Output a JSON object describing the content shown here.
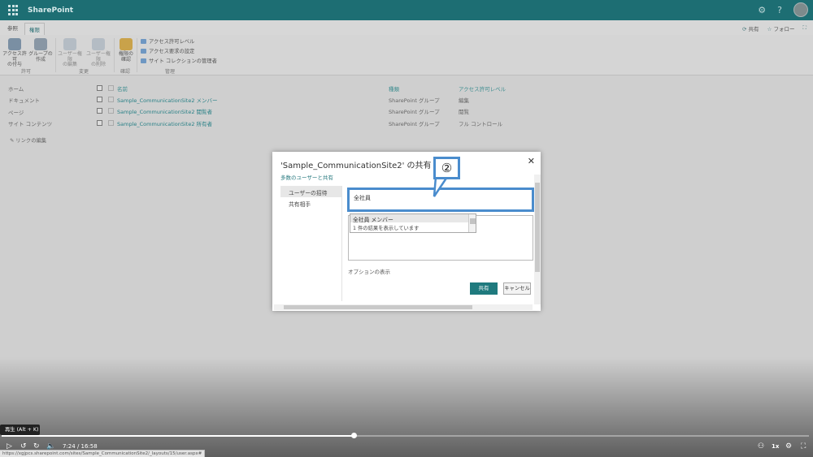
{
  "suitebar": {
    "brand": "SharePoint",
    "bg_color": "#1d6e73"
  },
  "tabs": {
    "items": [
      {
        "label": "参照"
      },
      {
        "label": "権限"
      }
    ],
    "right": {
      "share": "共有",
      "follow": "フォロー"
    }
  },
  "ribbon": {
    "buttons": [
      {
        "label_l1": "アクセス許可",
        "label_l2": "の付与"
      },
      {
        "label_l1": "グループの",
        "label_l2": "作成"
      },
      {
        "label_l1": "ユーザー権限",
        "label_l2": "の編集"
      },
      {
        "label_l1": "ユーザー権限",
        "label_l2": "の削除"
      },
      {
        "label_l1": "権限の",
        "label_l2": "確認"
      }
    ],
    "small_items": [
      "アクセス許可レベル",
      "アクセス要求の設定",
      "サイト コレクションの管理者"
    ],
    "groups": {
      "grant": "許可",
      "modify": "変更",
      "check": "確認",
      "manage": "管理"
    }
  },
  "leftnav": {
    "items": [
      "ホーム",
      "ドキュメント",
      "ページ",
      "サイト コンテンツ"
    ],
    "edit_links": "リンクの編集"
  },
  "group_table": {
    "headers": {
      "name": "名前",
      "type": "種類",
      "permission": "アクセス許可レベル"
    },
    "rows": [
      {
        "name": "Sample_CommunicationSite2 メンバー",
        "type": "SharePoint グループ",
        "permission": "編集"
      },
      {
        "name": "Sample_CommunicationSite2 閲覧者",
        "type": "SharePoint グループ",
        "permission": "閲覧"
      },
      {
        "name": "Sample_CommunicationSite2 所有者",
        "type": "SharePoint グループ",
        "permission": "フル コントロール"
      }
    ]
  },
  "dialog": {
    "title": "'Sample_CommunicationSite2' の共有",
    "subtitle": "多数のユーザーと共有",
    "nav": [
      "ユーザーの招待",
      "共有相手"
    ],
    "invite_value": "全社員",
    "suggestion": "全社員 メンバー",
    "result_count": "1 件の結果を表示しています",
    "options_label": "オプションの表示",
    "share_button": "共有",
    "cancel_button": "キャンセル"
  },
  "callout": {
    "label": "②",
    "color": "#4a8ccd"
  },
  "player": {
    "tooltip": "再生 (Alt + K)",
    "time": "7:24 / 16:58",
    "progress": 0.4365,
    "speed": "1x",
    "status_url": "https://xgjpcs.sharepoint.com/sites/Sample_CommunicationSite2/_layouts/15/user.aspx#"
  }
}
